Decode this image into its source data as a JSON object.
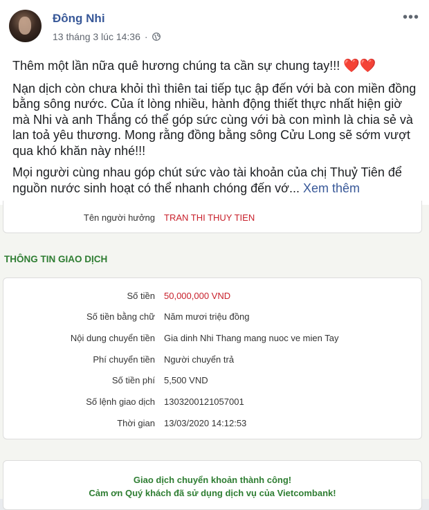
{
  "post": {
    "author": "Đông Nhi",
    "timestamp": "13 tháng 3 lúc 14:36",
    "visibility_icon": "globe-icon",
    "more_icon": "more-horizontal-icon",
    "paragraphs": {
      "p1": "Thêm một lần nữa quê hương chúng ta cần sự chung tay!!!",
      "p1_emoji": "❤️❤️",
      "p2": "Nạn dịch còn chưa khỏi thì thiên tai tiếp tục ập đến với bà con miền đồng bằng sông nước. Của ít lòng nhiều, hành động thiết thực nhất hiện giờ mà Nhi và anh Thắng có thể góp sức cùng với bà con mình là chia sẻ và lan toả yêu thương. Mong rằng đồng bằng sông Cửu Long sẽ sớm vượt qua khó khăn này nhé!!!",
      "p3": "Mọi người cùng nhau góp chút sức vào tài khoản của chị Thuỷ Tiên để nguồn nước sinh hoạt có thể nhanh chóng đến vớ...",
      "see_more": "Xem thêm"
    }
  },
  "receipt": {
    "beneficiary_label": "Tên người hưởng",
    "beneficiary_value": "TRAN THI THUY TIEN",
    "section_title": "THÔNG TIN GIAO DỊCH",
    "rows": [
      {
        "label": "Số tiền",
        "value": "50,000,000 VND"
      },
      {
        "label": "Số tiền bằng chữ",
        "value": "Năm mươi triệu đồng"
      },
      {
        "label": "Nội dung chuyển tiền",
        "value": "Gia dinh Nhi Thang mang nuoc ve mien Tay"
      },
      {
        "label": "Phí chuyển tiền",
        "value": "Người chuyển trả"
      },
      {
        "label": "Số tiền phí",
        "value": "5,500 VND"
      },
      {
        "label": "Số lệnh giao dịch",
        "value": "1303200121057001"
      },
      {
        "label": "Thời gian",
        "value": "13/03/2020 14:12:53"
      }
    ],
    "success_line1": "Giao dịch chuyển khoản thành công!",
    "success_line2": "Cảm ơn Quý khách đã sử dụng dịch vụ của Vietcombank!"
  },
  "colors": {
    "author_blue": "#385898",
    "amount_red": "#c8202b",
    "section_green": "#2e7d32"
  }
}
